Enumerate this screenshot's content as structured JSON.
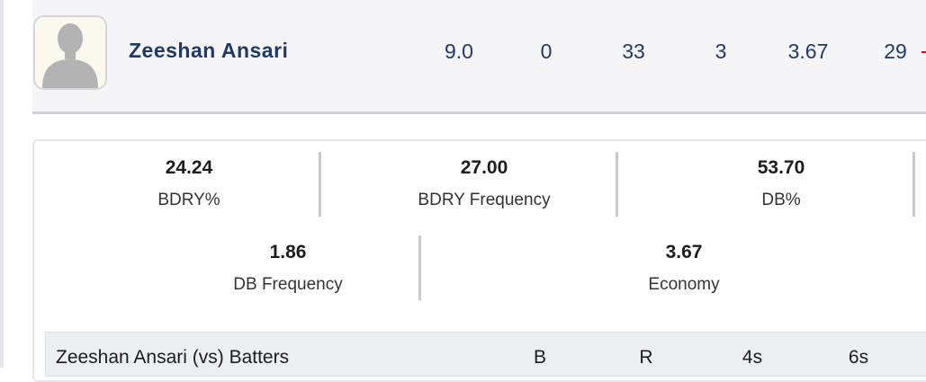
{
  "player": {
    "name": "Zeeshan Ansari",
    "stats": [
      "9.0",
      "0",
      "33",
      "3",
      "3.67",
      "29"
    ]
  },
  "metrics_row1": [
    {
      "value": "24.24",
      "label": "BDRY%"
    },
    {
      "value": "27.00",
      "label": "BDRY Frequency"
    },
    {
      "value": "53.70",
      "label": "DB%"
    }
  ],
  "metrics_row2": [
    {
      "value": "1.86",
      "label": "DB Frequency"
    },
    {
      "value": "3.67",
      "label": "Economy"
    }
  ],
  "batters": {
    "title": "Zeeshan Ansari (vs) Batters",
    "columns": [
      "B",
      "R",
      "4s",
      "6s"
    ]
  },
  "colors": {
    "name_blue": "#1e3a6a",
    "row_bg": "#f5f5f7",
    "accent_red": "#c6161a"
  },
  "icons": {
    "avatar": "person-silhouette-icon"
  }
}
